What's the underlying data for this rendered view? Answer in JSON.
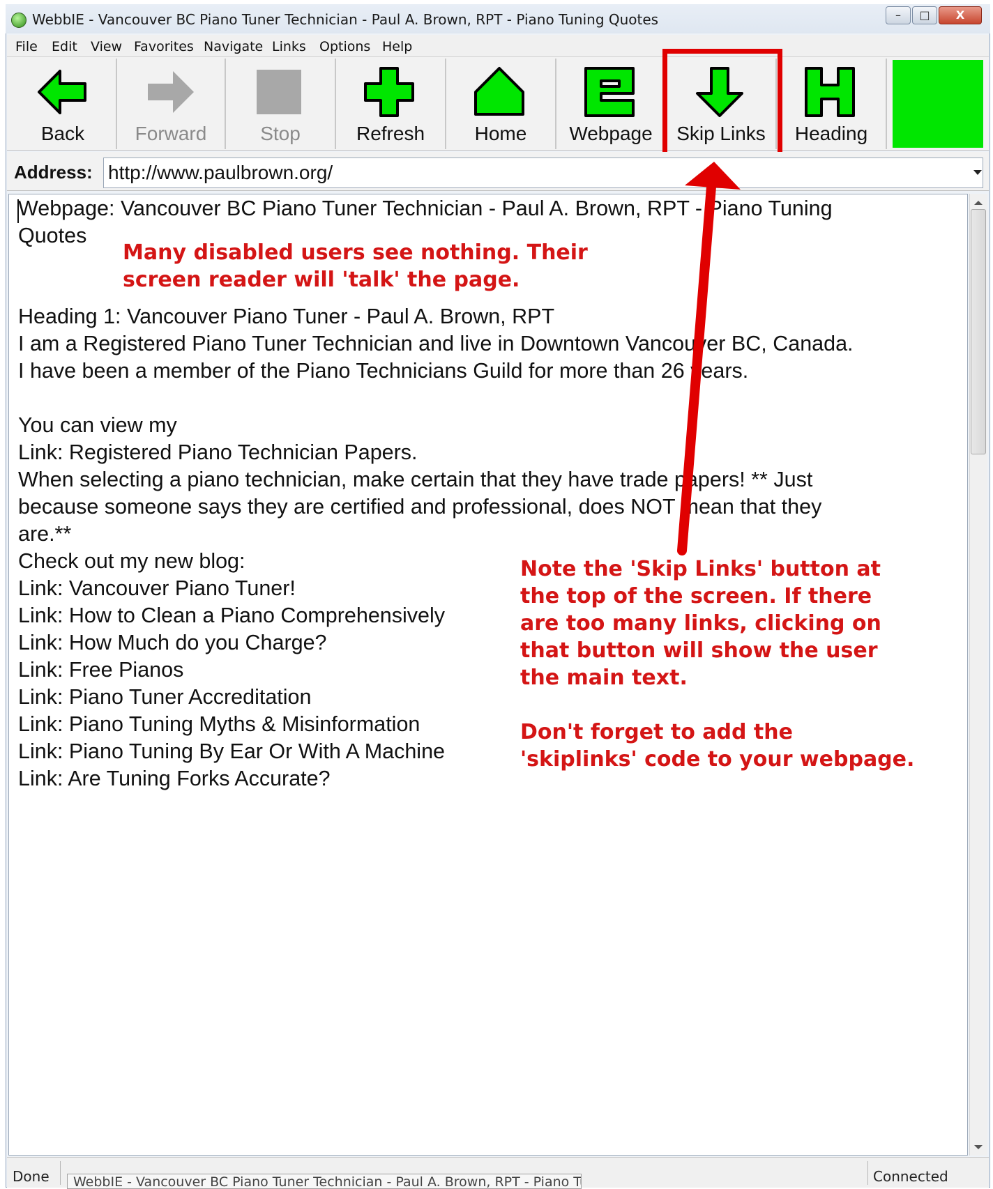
{
  "window": {
    "title": "WebbIE - Vancouver BC Piano Tuner Technician - Paul A. Brown, RPT - Piano Tuning Quotes",
    "controls": {
      "minimize": "–",
      "maximize": "□",
      "close": "X"
    }
  },
  "menu": [
    "File",
    "Edit",
    "View",
    "Favorites",
    "Navigate",
    "Links",
    "Options",
    "Help"
  ],
  "toolbar": [
    {
      "label": "Back",
      "icon": "arrow-left-icon",
      "enabled": true
    },
    {
      "label": "Forward",
      "icon": "arrow-right-icon",
      "enabled": false
    },
    {
      "label": "Stop",
      "icon": "stop-square-icon",
      "enabled": false
    },
    {
      "label": "Refresh",
      "icon": "plus-icon",
      "enabled": true
    },
    {
      "label": "Home",
      "icon": "house-icon",
      "enabled": true
    },
    {
      "label": "Webpage",
      "icon": "letter-e-icon",
      "enabled": true
    },
    {
      "label": "Skip Links",
      "icon": "arrow-down-icon",
      "enabled": true
    },
    {
      "label": "Heading",
      "icon": "letter-h-icon",
      "enabled": true
    }
  ],
  "colors": {
    "accent_green": "#00e600",
    "annotation_red": "#d41515"
  },
  "address": {
    "label": "Address:",
    "value": "http://www.paulbrown.org/"
  },
  "content": {
    "lines": [
      "Webpage: Vancouver BC Piano Tuner Technician - Paul A. Brown, RPT - Piano Tuning",
      "Quotes",
      "Heading 1: Vancouver Piano Tuner - Paul A. Brown, RPT",
      "I am a Registered Piano Tuner Technician and live in Downtown Vancouver BC, Canada.",
      "I have been a member of the Piano Technicians Guild for more than 26 years.",
      "You can view my",
      "Link: Registered Piano Technician Papers.",
      "When selecting a piano technician, make certain that they have trade papers! ** Just",
      "because someone says they are certified and professional, does NOT mean that they",
      "are.**",
      "Check out my new blog:",
      "Link: Vancouver Piano Tuner!",
      "Link: How to Clean a Piano Comprehensively",
      "Link: How Much do you Charge?",
      "Link: Free Pianos",
      "Link: Piano Tuner Accreditation",
      "Link: Piano Tuning Myths & Misinformation",
      "Link: Piano Tuning By Ear Or With A Machine",
      "Link: Are Tuning Forks Accurate?"
    ]
  },
  "annotations": {
    "top": [
      "Many disabled users see nothing. Their",
      "screen reader will 'talk' the page."
    ],
    "right": [
      "Note the 'Skip Links' button at",
      "the top of the screen. If there",
      "are too many links, clicking on",
      "that button will show the user",
      "the main text."
    ],
    "bottom": [
      "Don't forget to add the",
      "'skiplinks' code to your webpage."
    ]
  },
  "status": {
    "left": "Done",
    "title": "WebbIE - Vancouver BC Piano Tuner Technician - Paul A. Brown, RPT - Piano Tunin",
    "right": "Connected"
  }
}
